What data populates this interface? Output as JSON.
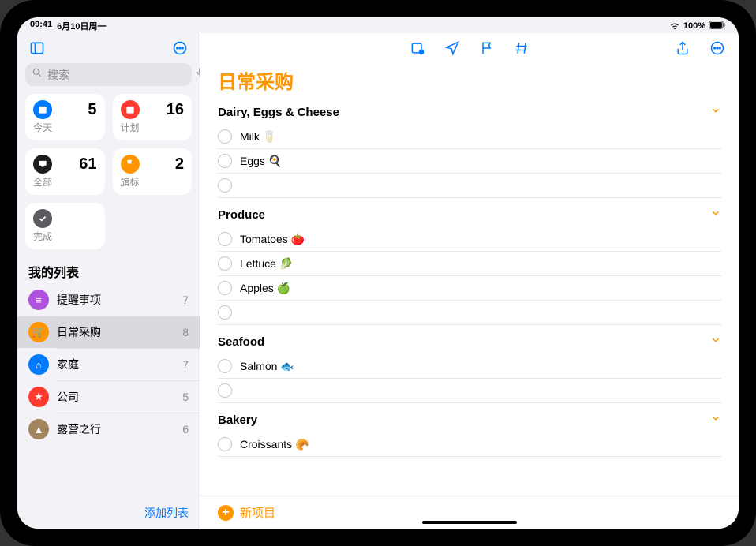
{
  "status": {
    "time": "09:41",
    "date": "6月10日周一",
    "battery": "100%"
  },
  "sidebar": {
    "search_placeholder": "搜索",
    "smart": {
      "today": {
        "label": "今天",
        "count": "5"
      },
      "scheduled": {
        "label": "计划",
        "count": "16"
      },
      "all": {
        "label": "全部",
        "count": "61"
      },
      "flagged": {
        "label": "旗标",
        "count": "2"
      },
      "completed": {
        "label": "完成"
      }
    },
    "lists_title": "我的列表",
    "lists": [
      {
        "name": "提醒事项",
        "count": "7",
        "color": "bg-purple",
        "glyph": "≡"
      },
      {
        "name": "日常采购",
        "count": "8",
        "color": "bg-orange",
        "glyph": "🛒",
        "active": true
      },
      {
        "name": "家庭",
        "count": "7",
        "color": "bg-blue",
        "glyph": "⌂"
      },
      {
        "name": "公司",
        "count": "5",
        "color": "bg-red",
        "glyph": "★"
      },
      {
        "name": "露营之行",
        "count": "6",
        "color": "bg-brown",
        "glyph": "▲"
      }
    ],
    "add_list": "添加列表"
  },
  "main": {
    "title": "日常采购",
    "new_item": "新项目",
    "sections": [
      {
        "name": "Dairy, Eggs & Cheese",
        "items": [
          {
            "text": "Milk 🥛"
          },
          {
            "text": "Eggs 🍳"
          },
          {
            "text": ""
          }
        ]
      },
      {
        "name": "Produce",
        "items": [
          {
            "text": "Tomatoes 🍅"
          },
          {
            "text": "Lettuce 🥬"
          },
          {
            "text": "Apples 🍏"
          },
          {
            "text": ""
          }
        ]
      },
      {
        "name": "Seafood",
        "items": [
          {
            "text": "Salmon 🐟"
          },
          {
            "text": ""
          }
        ]
      },
      {
        "name": "Bakery",
        "items": [
          {
            "text": "Croissants 🥐"
          }
        ]
      }
    ]
  }
}
